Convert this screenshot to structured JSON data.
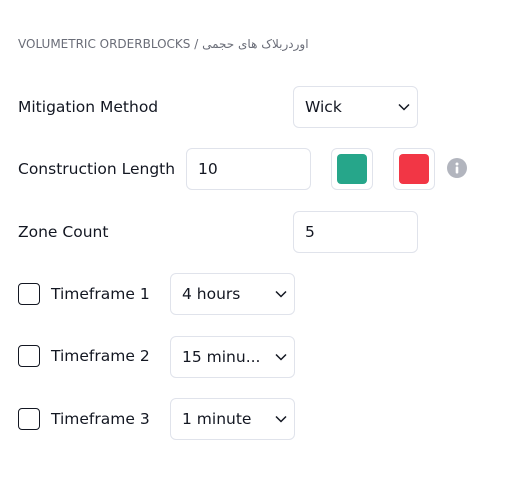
{
  "breadcrumb": {
    "title": "VOLUMETRIC ORDERBLOCKS",
    "separator": "/",
    "subtitle": "اوردربلاک های حجمی"
  },
  "settings": {
    "mitigation": {
      "label": "Mitigation Method",
      "value": "Wick"
    },
    "construction": {
      "label": "Construction Length",
      "value": "10",
      "bull_color": "#26a68a",
      "bear_color": "#f23645"
    },
    "zone_count": {
      "label": "Zone Count",
      "value": "5"
    },
    "timeframes": [
      {
        "label": "Timeframe 1",
        "value": "4 hours",
        "checked": false
      },
      {
        "label": "Timeframe 2",
        "value": "15 minu...",
        "checked": false
      },
      {
        "label": "Timeframe 3",
        "value": "1 minute",
        "checked": false
      }
    ]
  },
  "icons": {
    "dropdown": "chevron-down-icon",
    "info": "info-icon"
  }
}
